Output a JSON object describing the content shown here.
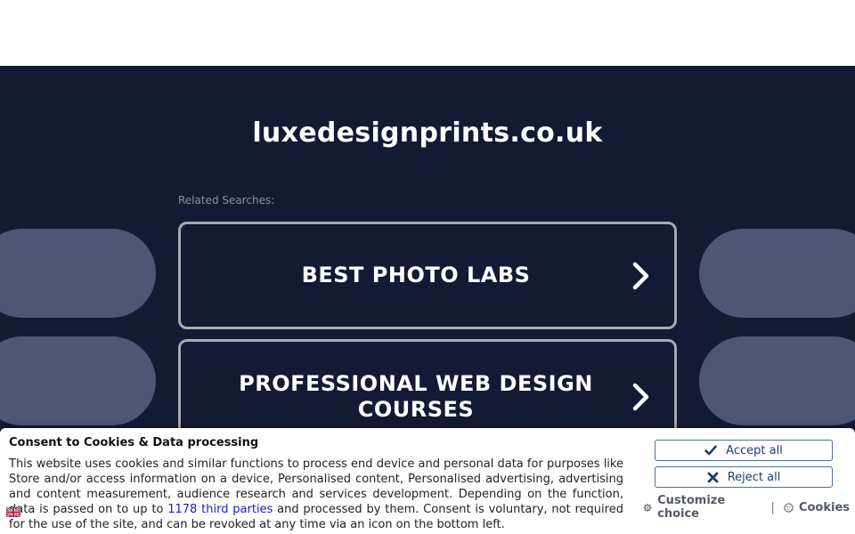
{
  "page": {
    "domain": "luxedesignprints.co.uk",
    "related_label": "Related Searches:"
  },
  "searches": [
    {
      "label": "BEST PHOTO LABS"
    },
    {
      "label": "PROFESSIONAL WEB DESIGN COURSES"
    }
  ],
  "consent": {
    "title": "Consent to Cookies & Data processing",
    "text_before": "This website uses cookies and similar functions to process end device and personal data for purposes like Store and/or access information on a device, Personalised content, Personalised advertising, advertising and content measurement, audience research and services development. Depending on the function, data is passed on to up to ",
    "third_parties_link": "1178 third parties",
    "text_after": " and processed by them. Consent is voluntary, not required for the use of the site, and can be revoked at any time via an icon on the bottom left.",
    "accept_label": "Accept all",
    "reject_label": "Reject all",
    "customize_label": "Customize choice",
    "separator": "|",
    "cookies_label": "Cookies"
  },
  "colors": {
    "background": "#141a33",
    "pill": "#4e5675",
    "button_border": "#a9a9ae",
    "consent_button": "#1f3c7a"
  },
  "icons": {
    "chevron": "chevron-right-icon",
    "accept": "check-icon",
    "reject": "close-icon",
    "customize": "gear-icon",
    "cookies": "cookie-icon",
    "language": "uk-flag-icon"
  }
}
